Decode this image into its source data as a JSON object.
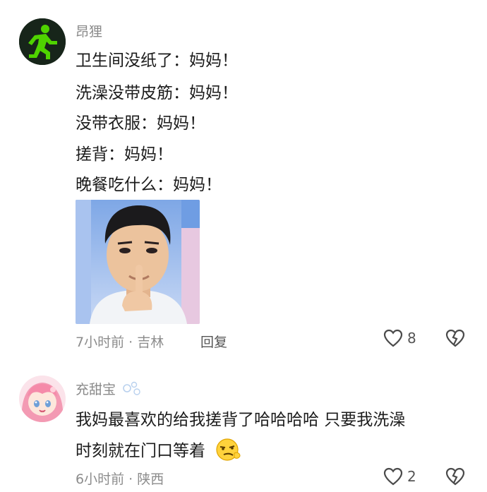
{
  "comments": [
    {
      "username": "昂狸",
      "lines": [
        "卫生间没纸了：妈妈！",
        "洗澡没带皮筋：妈妈！",
        "没带衣服：妈妈！",
        "搓背：妈妈！",
        "晚餐吃什么：妈妈！"
      ],
      "meta": "7小时前 · 吉林",
      "reply_label": "回复",
      "likes": "8",
      "avatar_icon": "running-man-icon"
    },
    {
      "username": "充甜宝",
      "lines": [
        "我妈最喜欢的给我搓背了哈哈哈哈 只要我洗澡",
        "时刻就在门口等着"
      ],
      "meta": "6小时前 · 陕西",
      "likes": "2",
      "avatar_icon": "anime-girl-icon",
      "emoji": "smirk-emoji-icon"
    }
  ],
  "colors": {
    "accent_green": "#4fd300",
    "avatar_bg": "#1a2e1a",
    "muted": "#8a8a8a"
  }
}
